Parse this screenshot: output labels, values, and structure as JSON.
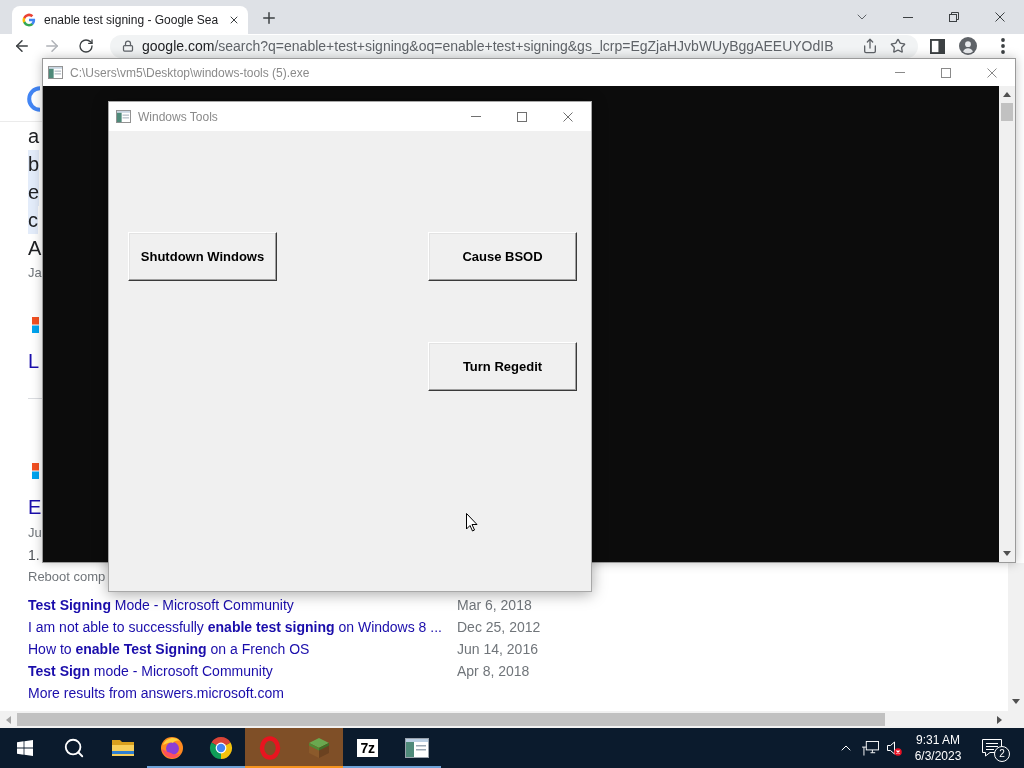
{
  "browser": {
    "tabs": [
      {
        "title": "enable test signing - Google Sea",
        "selected": true
      }
    ],
    "address": {
      "host": "google.com",
      "path": "/search?q=enable+test+signing&oq=enable+test+signing&gs_lcrp=EgZjaHJvbWUyBggAEEUYOdIB"
    },
    "page": {
      "fragments": [
        {
          "kind": "snippet",
          "text": "a",
          "highlighted": false
        },
        {
          "kind": "snippet",
          "text": "b",
          "highlighted": true
        },
        {
          "kind": "snippet",
          "text": "e",
          "highlighted": true
        },
        {
          "kind": "snippet",
          "text": "c",
          "highlighted": true
        },
        {
          "kind": "snippet",
          "text": "A",
          "highlighted": false
        },
        {
          "kind": "meta",
          "text": "Ja"
        },
        {
          "kind": "title",
          "text": "L"
        },
        {
          "kind": "divider"
        },
        {
          "kind": "title",
          "text": "E"
        },
        {
          "kind": "meta",
          "text": "Ju"
        },
        {
          "kind": "body",
          "text": "1."
        },
        {
          "kind": "meta",
          "text": "Reboot comp"
        }
      ],
      "more_results": [
        {
          "title": "**Test Signing** Mode - Microsoft Community",
          "date": "Mar 6, 2018"
        },
        {
          "title": "I am not able to successfully **enable test signing** on Windows 8 ...",
          "date": "Dec 25, 2012"
        },
        {
          "title": "How to **enable Test Signing** on a French OS",
          "date": "Jun 14, 2016"
        },
        {
          "title": "**Test Sign** mode - Microsoft Community",
          "date": "Apr 8, 2018"
        }
      ],
      "more_link": "More results from answers.microsoft.com"
    }
  },
  "console_window": {
    "title": "C:\\Users\\vm5\\Desktop\\windows-tools (5).exe"
  },
  "tools_window": {
    "title": "Windows Tools",
    "left_buttons": [
      "Shutdown Windows"
    ],
    "right_buttons": [
      "Cause BSOD",
      "Turn Regedit"
    ]
  },
  "taskbar": {
    "apps": [
      {
        "kind": "start",
        "running": false,
        "flashing": false
      },
      {
        "kind": "search",
        "running": false,
        "flashing": false
      },
      {
        "kind": "folder",
        "running": false,
        "flashing": false
      },
      {
        "kind": "fox_globe",
        "running": true,
        "flashing": false
      },
      {
        "kind": "segmented_circle",
        "running": true,
        "flashing": false
      },
      {
        "kind": "red_ring",
        "running": true,
        "flashing": true
      },
      {
        "kind": "grass_block",
        "running": true,
        "flashing": true
      },
      {
        "kind": "text_logo",
        "label": "7z",
        "running": true,
        "flashing": false
      },
      {
        "kind": "window",
        "running": true,
        "flashing": false
      }
    ],
    "clock": {
      "time": "9:31 AM",
      "date": "6/3/2023"
    },
    "notifications": {
      "count": "2"
    }
  }
}
